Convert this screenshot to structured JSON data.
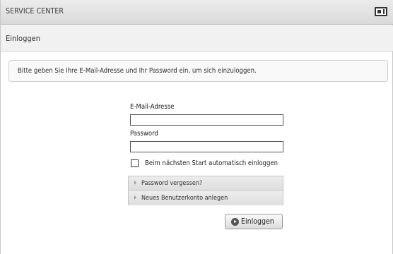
{
  "window": {
    "title": "SERVICE CENTER",
    "icon": "window-mode-icon"
  },
  "page": {
    "heading": "Einloggen"
  },
  "info": {
    "text": "Bitte geben Sie Ihre E-Mail-Adresse und Ihr Password ein, um sich einzuloggen."
  },
  "form": {
    "email_label": "E-Mail-Adresse",
    "email_value": "",
    "password_label": "Password",
    "password_value": "",
    "remember_label": "Beim nächsten Start automatisch einloggen",
    "remember_checked": false
  },
  "links": {
    "forgot": "Password vergessen?",
    "create_account": "Neues Benutzerkonto anlegen"
  },
  "actions": {
    "login_label": "Einloggen",
    "login_icon": "play-circle-icon"
  }
}
